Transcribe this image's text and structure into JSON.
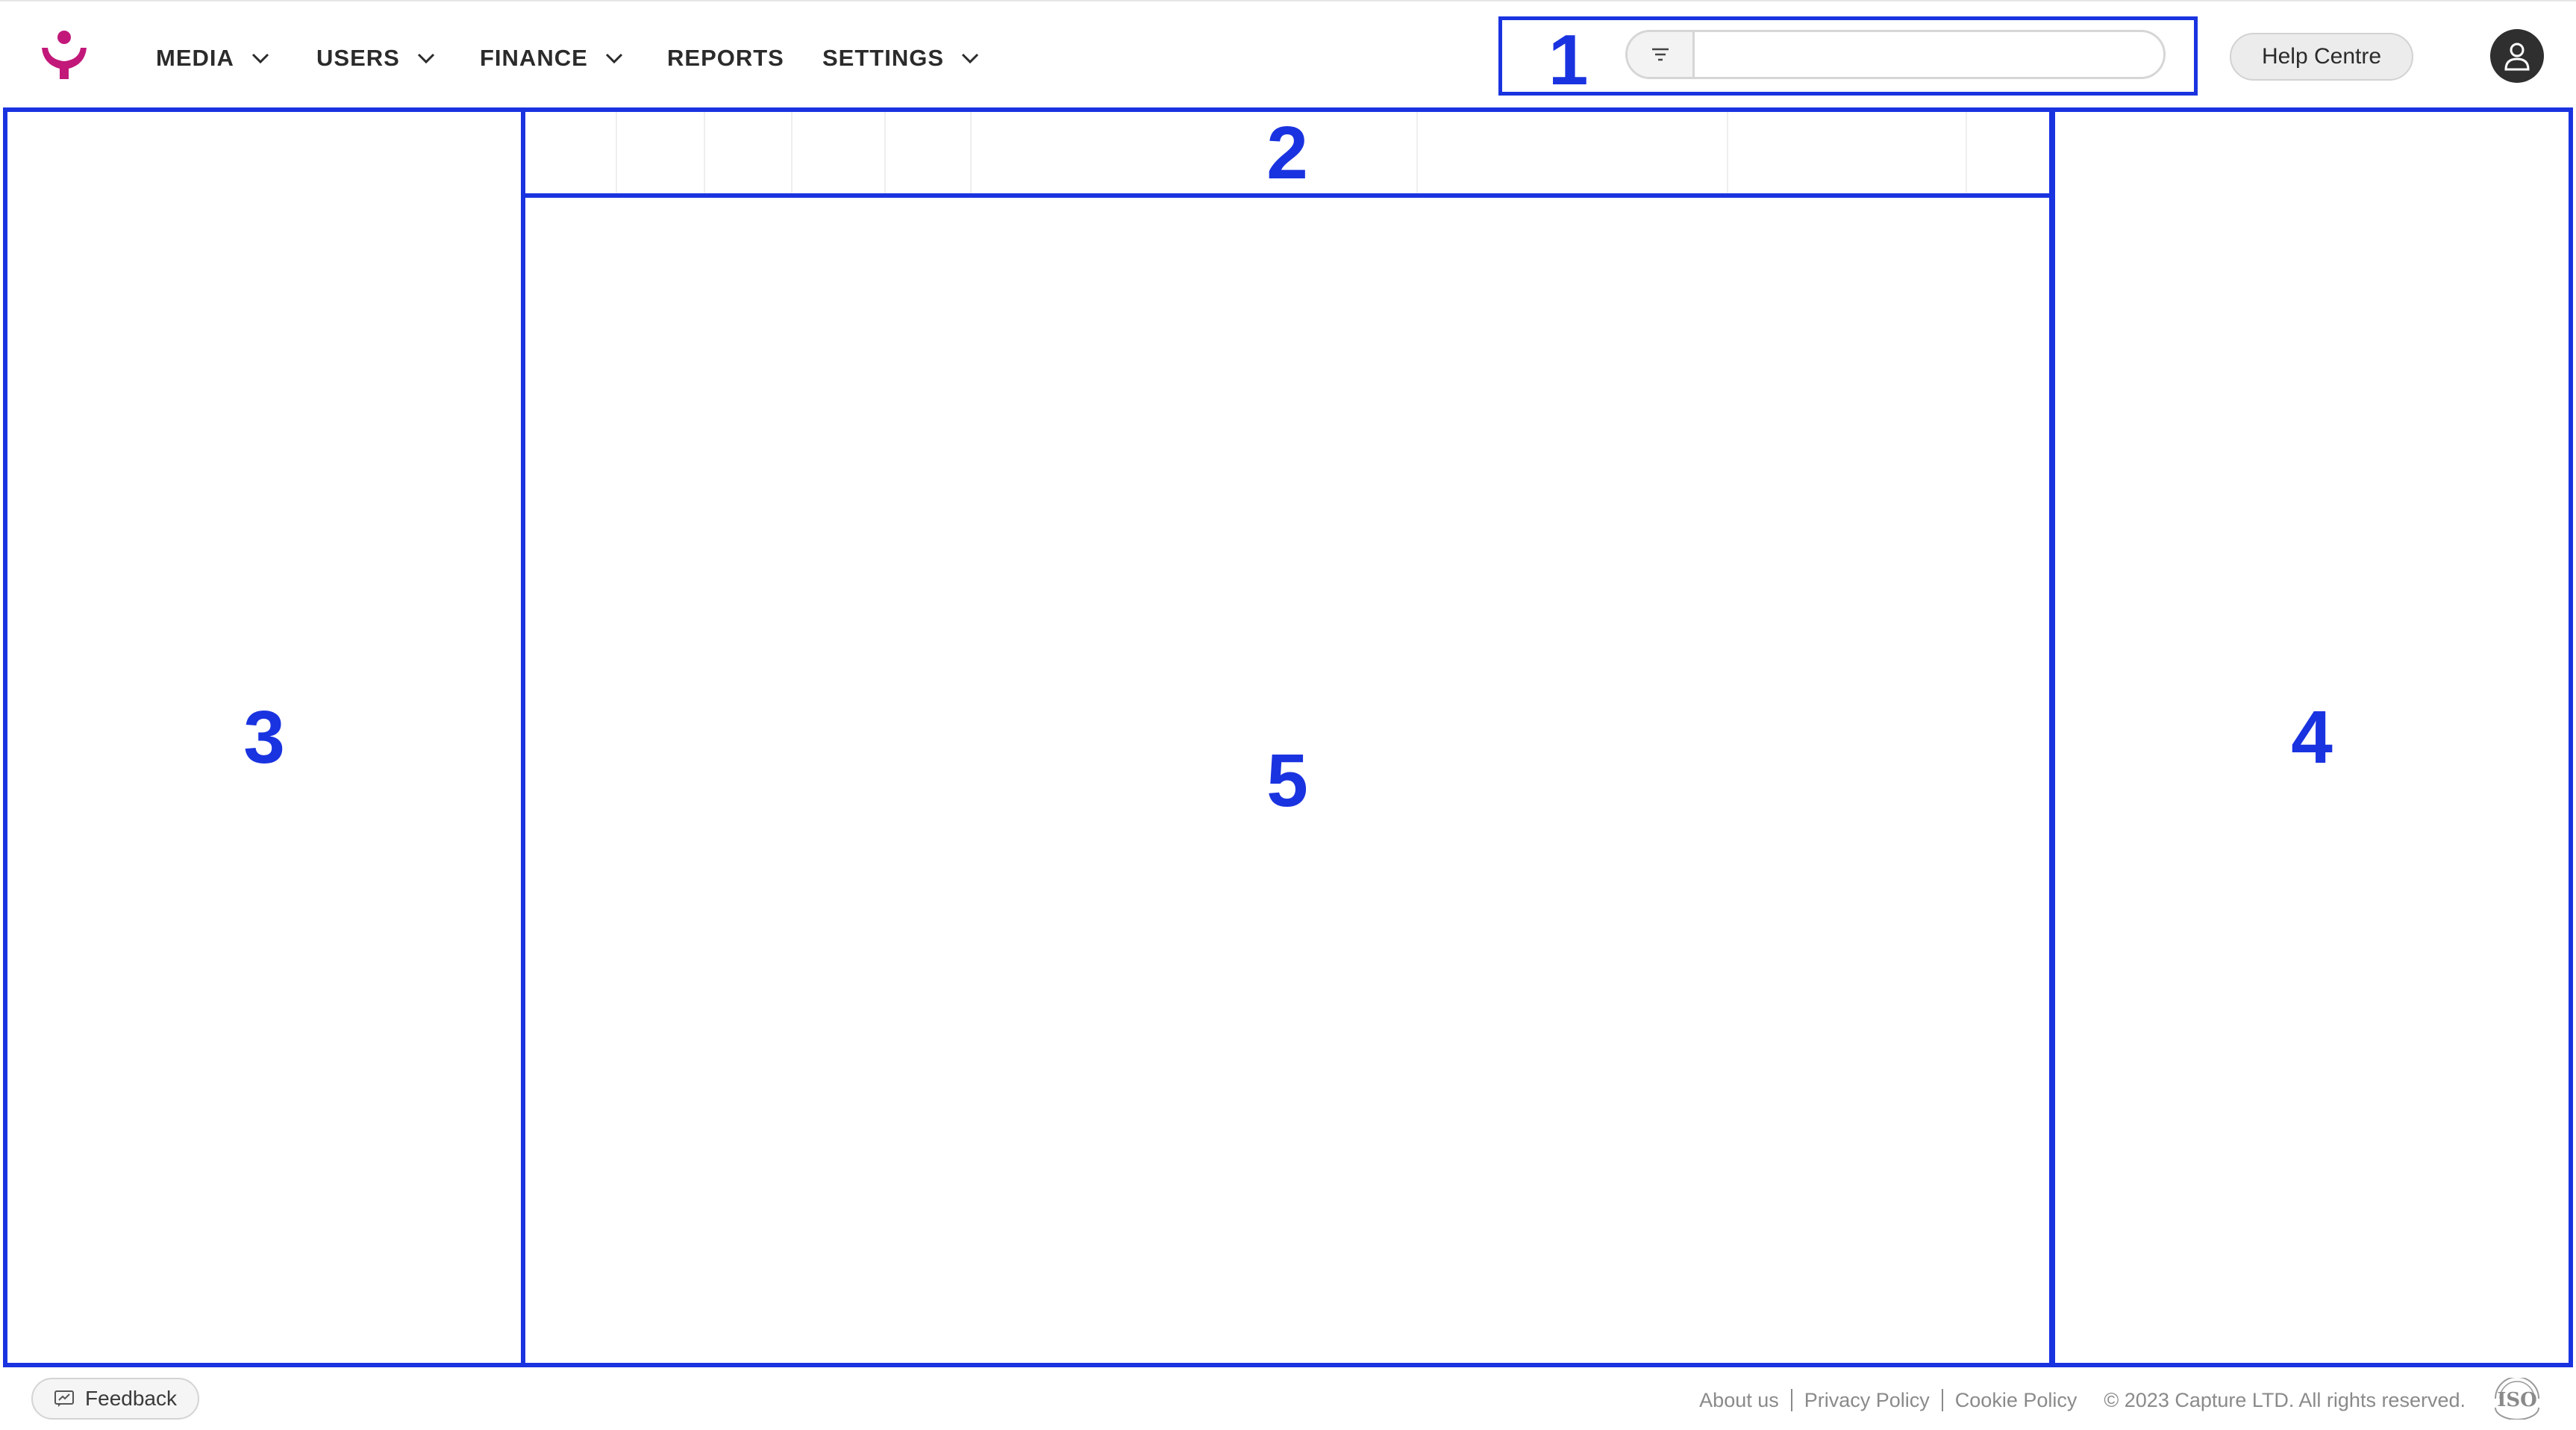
{
  "nav": {
    "items": [
      {
        "label": "MEDIA",
        "has_dropdown": true
      },
      {
        "label": "USERS",
        "has_dropdown": true
      },
      {
        "label": "FINANCE",
        "has_dropdown": true
      },
      {
        "label": "REPORTS",
        "has_dropdown": false
      },
      {
        "label": "SETTINGS",
        "has_dropdown": true
      }
    ]
  },
  "search": {
    "value": "",
    "placeholder": "",
    "filter_icon": "filter-icon"
  },
  "header": {
    "help_label": "Help Centre",
    "avatar_icon": "user-avatar-icon"
  },
  "annotations": [
    "1",
    "2",
    "3",
    "4",
    "5"
  ],
  "footer": {
    "feedback_label": "Feedback",
    "links": [
      "About us",
      "Privacy Policy",
      "Cookie Policy"
    ],
    "copyright": "© 2023 Capture LTD. All rights reserved.",
    "badge_text": "ISO"
  },
  "colors": {
    "brand": "#c2187a",
    "annotation": "#1a33e0"
  }
}
